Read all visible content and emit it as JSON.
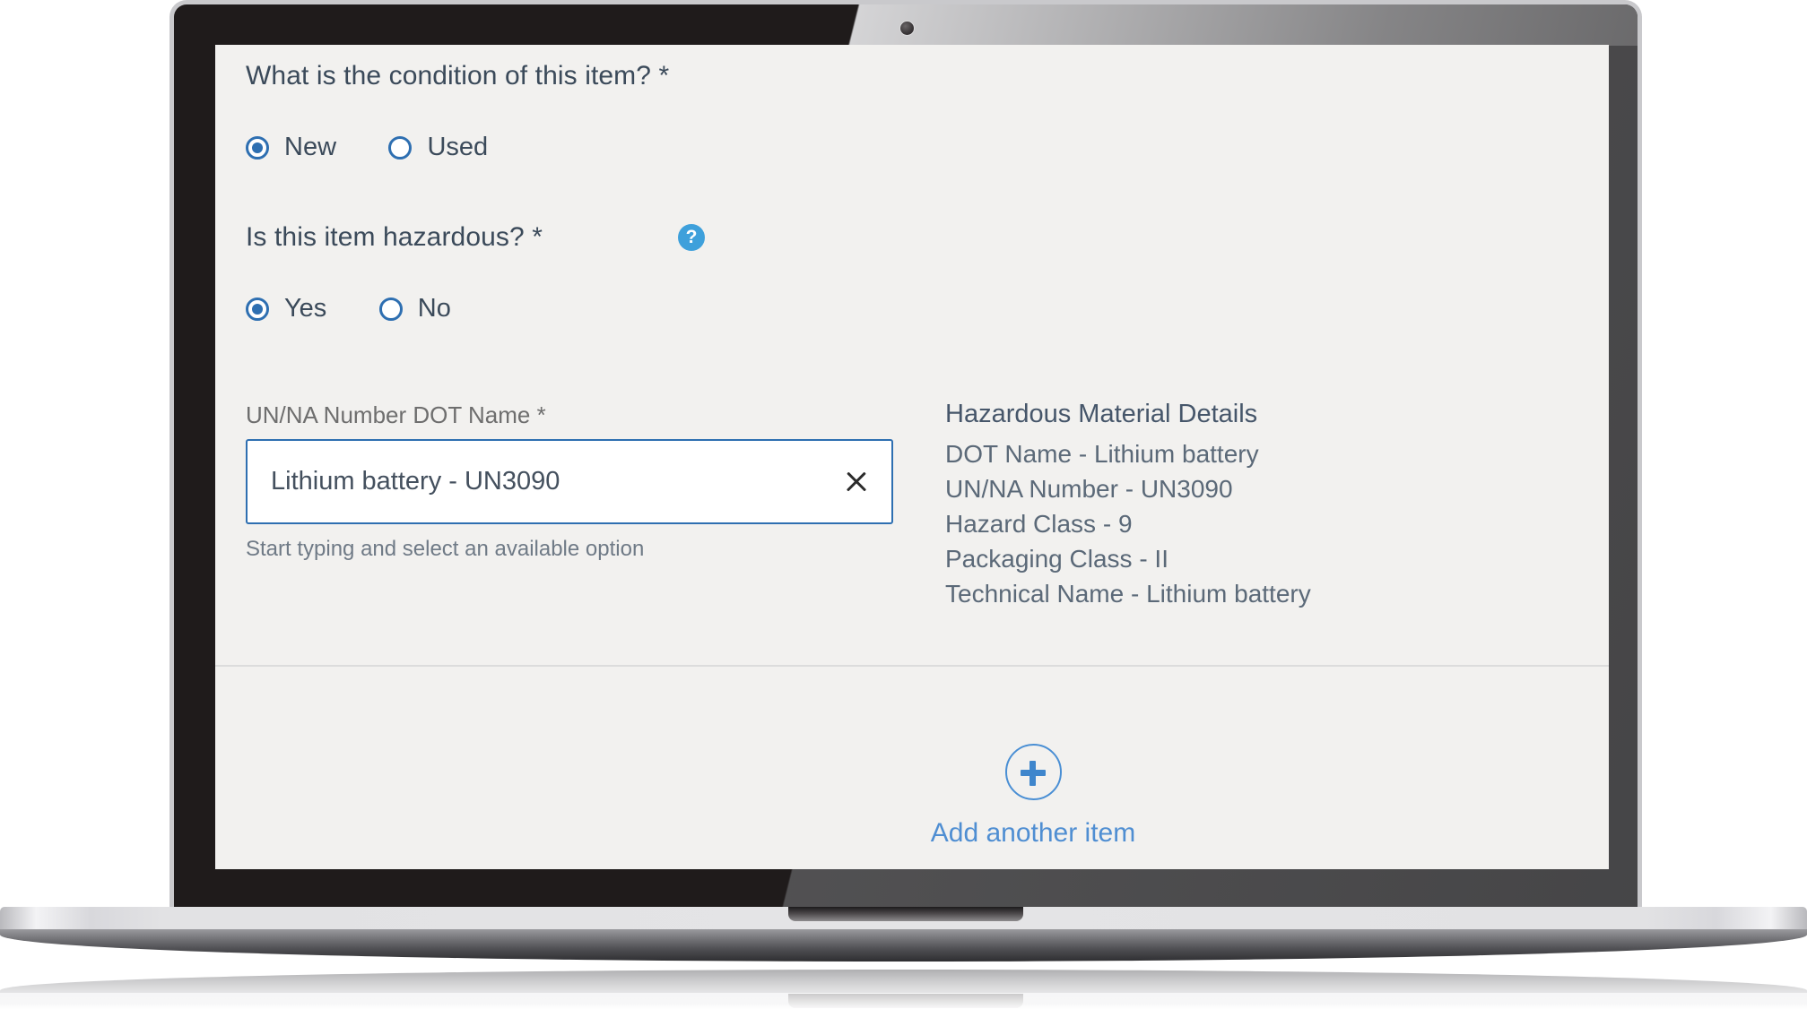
{
  "device": {
    "type": "laptop-mockup",
    "camera_icon": "camera-dot"
  },
  "form": {
    "condition": {
      "question": "What is the condition of this item? *",
      "options": [
        {
          "label": "New",
          "selected": true
        },
        {
          "label": "Used",
          "selected": false
        }
      ]
    },
    "hazardous": {
      "question": "Is this item hazardous? *",
      "help_icon": "question-mark-icon",
      "options": [
        {
          "label": "Yes",
          "selected": true
        },
        {
          "label": "No",
          "selected": false
        }
      ]
    },
    "un_na_field": {
      "label": "UN/NA Number DOT Name *",
      "value": "Lithium battery - UN3090",
      "placeholder": "Start typing and select an available option",
      "hint": "Start typing and select an available option",
      "clear_icon": "close-x-icon"
    },
    "hazmat_details": {
      "title": "Hazardous Material Details",
      "lines": [
        "DOT Name - Lithium battery",
        "UN/NA Number - UN3090",
        "Hazard Class - 9",
        "Packaging Class - II",
        "Technical Name - Lithium battery"
      ]
    },
    "add_item": {
      "icon": "plus-circle-icon",
      "label": "Add another item"
    }
  },
  "colors": {
    "accent_blue": "#2e6fb1",
    "link_blue": "#4f8ed2",
    "help_blue": "#3ea0db",
    "text_dark": "#3b4a5a",
    "text_muted": "#6e6e6e",
    "page_bg": "#f2f1ef",
    "divider": "#dcdcdc"
  }
}
